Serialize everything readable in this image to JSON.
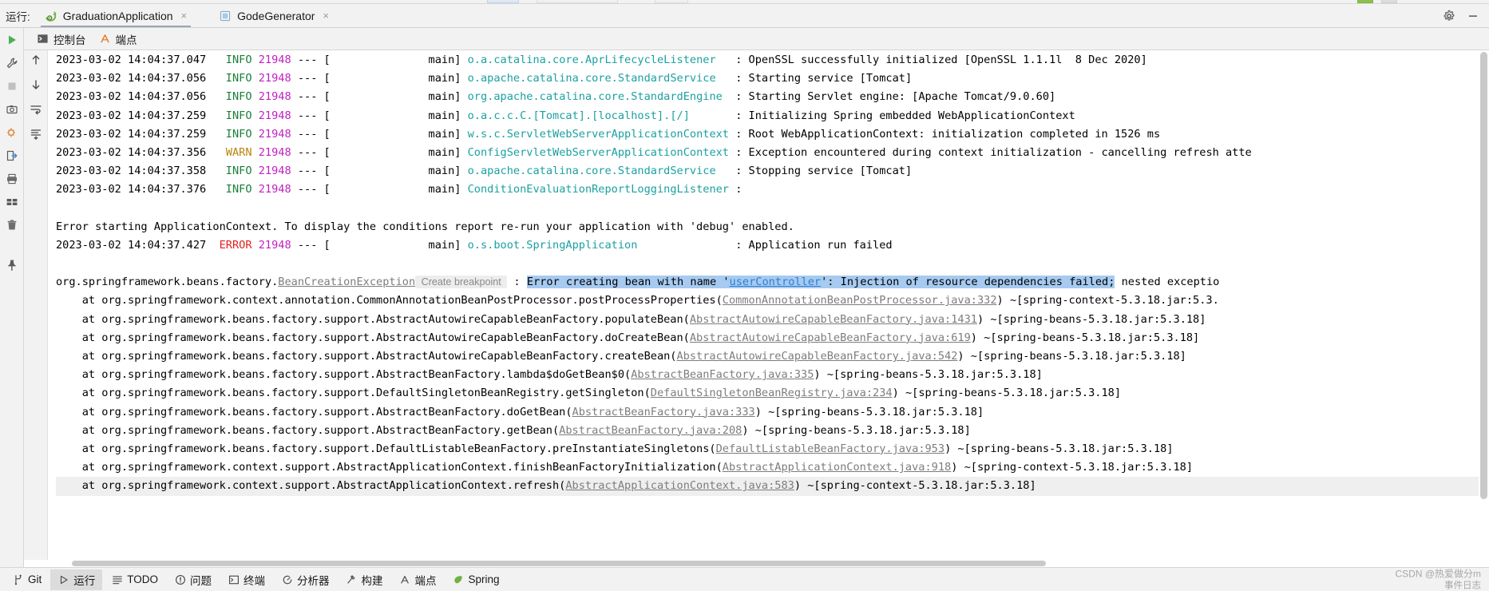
{
  "window": {
    "run_label": "运行:",
    "gear_icon": "gear-icon",
    "minimize_icon": "minimize-icon"
  },
  "tabs": [
    {
      "label": "GraduationApplication",
      "icon": "spring-boot-icon",
      "close": "×",
      "active": true
    },
    {
      "label": "GodeGenerator",
      "icon": "application-icon",
      "close": "×",
      "active": false
    }
  ],
  "console_tabs": [
    {
      "label": "控制台",
      "icon": "console-icon",
      "active": true
    },
    {
      "label": "端点",
      "icon": "endpoints-icon",
      "active": false
    }
  ],
  "left_toolbar": [
    "run-icon",
    "wrench-icon",
    "stop-icon",
    "camera-icon",
    "bug-settings-icon",
    "exit-icon",
    "print-icon",
    "layout-icon",
    "trash-icon",
    "pin-icon"
  ],
  "inner_gutter": [
    "scroll-up-icon",
    "scroll-down-icon",
    "soft-wrap-icon",
    "scroll-to-end-icon"
  ],
  "log": {
    "lines": [
      {
        "type": "log",
        "ts": "2023-03-02 14:04:37.047",
        "level": "INFO",
        "pid": "21948",
        "sep": "--- [",
        "thread": "main]",
        "logger": "o.a.catalina.core.AprLifecycleListener",
        "colon": ":",
        "message": "OpenSSL successfully initialized [OpenSSL 1.1.1l  8 Dec 2020]",
        "clipped": true
      },
      {
        "type": "log",
        "ts": "2023-03-02 14:04:37.056",
        "level": "INFO",
        "pid": "21948",
        "sep": "--- [",
        "thread": "main]",
        "logger": "o.apache.catalina.core.StandardService",
        "colon": ":",
        "message": "Starting service [Tomcat]"
      },
      {
        "type": "log",
        "ts": "2023-03-02 14:04:37.056",
        "level": "INFO",
        "pid": "21948",
        "sep": "--- [",
        "thread": "main]",
        "logger": "org.apache.catalina.core.StandardEngine",
        "colon": ":",
        "message": "Starting Servlet engine: [Apache Tomcat/9.0.60]"
      },
      {
        "type": "log",
        "ts": "2023-03-02 14:04:37.259",
        "level": "INFO",
        "pid": "21948",
        "sep": "--- [",
        "thread": "main]",
        "logger": "o.a.c.c.C.[Tomcat].[localhost].[/]",
        "colon": ":",
        "message": "Initializing Spring embedded WebApplicationContext"
      },
      {
        "type": "log",
        "ts": "2023-03-02 14:04:37.259",
        "level": "INFO",
        "pid": "21948",
        "sep": "--- [",
        "thread": "main]",
        "logger": "w.s.c.ServletWebServerApplicationContext",
        "colon": ":",
        "message": "Root WebApplicationContext: initialization completed in 1526 ms"
      },
      {
        "type": "log",
        "ts": "2023-03-02 14:04:37.356",
        "level": "WARN",
        "pid": "21948",
        "sep": "--- [",
        "thread": "main]",
        "logger": "ConfigServletWebServerApplicationContext",
        "colon": ":",
        "message": "Exception encountered during context initialization - cancelling refresh atte",
        "clipped": true
      },
      {
        "type": "log",
        "ts": "2023-03-02 14:04:37.358",
        "level": "INFO",
        "pid": "21948",
        "sep": "--- [",
        "thread": "main]",
        "logger": "o.apache.catalina.core.StandardService",
        "colon": ":",
        "message": "Stopping service [Tomcat]"
      },
      {
        "type": "log",
        "ts": "2023-03-02 14:04:37.376",
        "level": "INFO",
        "pid": "21948",
        "sep": "--- [",
        "thread": "main]",
        "logger": "ConditionEvaluationReportLoggingListener",
        "colon": ":",
        "message": ""
      },
      {
        "type": "blank"
      },
      {
        "type": "plain",
        "text": "Error starting ApplicationContext. To display the conditions report re-run your application with 'debug' enabled."
      },
      {
        "type": "log",
        "ts": "2023-03-02 14:04:37.427",
        "level": "ERROR",
        "pid": "21948",
        "sep": "--- [",
        "thread": "main]",
        "logger": "o.s.boot.SpringApplication",
        "colon": ":",
        "message": "Application run failed"
      },
      {
        "type": "blank"
      },
      {
        "type": "exception_head",
        "prefix": "org.springframework.beans.factory.",
        "link": "BeanCreationException",
        "breakpoint": "Create breakpoint",
        "colon": ":",
        "sel_before": "Error creating bean with name '",
        "sel_link": "userController",
        "sel_after": "': Injection of resource dependencies failed;",
        "tail": " nested exceptio",
        "clipped": true
      },
      {
        "type": "trace",
        "prefix": "at org.springframework.context.annotation.CommonAnnotationBeanPostProcessor.postProcessProperties(",
        "link": "CommonAnnotationBeanPostProcessor.java:332",
        "suffix": ") ~[spring-context-5.3.18.jar:5.3.",
        "clipped": true
      },
      {
        "type": "trace",
        "prefix": "at org.springframework.beans.factory.support.AbstractAutowireCapableBeanFactory.populateBean(",
        "link": "AbstractAutowireCapableBeanFactory.java:1431",
        "suffix": ") ~[spring-beans-5.3.18.jar:5.3.18]"
      },
      {
        "type": "trace",
        "prefix": "at org.springframework.beans.factory.support.AbstractAutowireCapableBeanFactory.doCreateBean(",
        "link": "AbstractAutowireCapableBeanFactory.java:619",
        "suffix": ") ~[spring-beans-5.3.18.jar:5.3.18]"
      },
      {
        "type": "trace",
        "prefix": "at org.springframework.beans.factory.support.AbstractAutowireCapableBeanFactory.createBean(",
        "link": "AbstractAutowireCapableBeanFactory.java:542",
        "suffix": ") ~[spring-beans-5.3.18.jar:5.3.18]"
      },
      {
        "type": "trace",
        "prefix": "at org.springframework.beans.factory.support.AbstractBeanFactory.lambda$doGetBean$0(",
        "link": "AbstractBeanFactory.java:335",
        "suffix": ") ~[spring-beans-5.3.18.jar:5.3.18]"
      },
      {
        "type": "trace",
        "prefix": "at org.springframework.beans.factory.support.DefaultSingletonBeanRegistry.getSingleton(",
        "link": "DefaultSingletonBeanRegistry.java:234",
        "suffix": ") ~[spring-beans-5.3.18.jar:5.3.18]"
      },
      {
        "type": "trace",
        "prefix": "at org.springframework.beans.factory.support.AbstractBeanFactory.doGetBean(",
        "link": "AbstractBeanFactory.java:333",
        "suffix": ") ~[spring-beans-5.3.18.jar:5.3.18]"
      },
      {
        "type": "trace",
        "prefix": "at org.springframework.beans.factory.support.AbstractBeanFactory.getBean(",
        "link": "AbstractBeanFactory.java:208",
        "suffix": ") ~[spring-beans-5.3.18.jar:5.3.18]"
      },
      {
        "type": "trace",
        "prefix": "at org.springframework.beans.factory.support.DefaultListableBeanFactory.preInstantiateSingletons(",
        "link": "DefaultListableBeanFactory.java:953",
        "suffix": ") ~[spring-beans-5.3.18.jar:5.3.18]"
      },
      {
        "type": "trace",
        "prefix": "at org.springframework.context.support.AbstractApplicationContext.finishBeanFactoryInitialization(",
        "link": "AbstractApplicationContext.java:918",
        "suffix": ") ~[spring-context-5.3.18.jar:5.3.18]"
      },
      {
        "type": "trace",
        "highlighted": true,
        "prefix": "at org.springframework.context.support.AbstractApplicationContext.refresh(",
        "link": "AbstractApplicationContext.java:583",
        "suffix": ") ~[spring-context-5.3.18.jar:5.3.18]"
      }
    ]
  },
  "statusbar": {
    "items": [
      {
        "label": "Git",
        "icon": "git-branch-icon",
        "active": false
      },
      {
        "label": "运行",
        "icon": "run-icon",
        "active": true
      },
      {
        "label": "TODO",
        "icon": "todo-icon",
        "active": false
      },
      {
        "label": "问题",
        "icon": "problems-icon",
        "active": false
      },
      {
        "label": "终端",
        "icon": "terminal-icon",
        "active": false
      },
      {
        "label": "分析器",
        "icon": "profiler-icon",
        "active": false
      },
      {
        "label": "构建",
        "icon": "build-icon",
        "active": false
      },
      {
        "label": "端点",
        "icon": "endpoints-icon",
        "active": false
      },
      {
        "label": "Spring",
        "icon": "spring-leaf-icon",
        "active": false
      }
    ],
    "watermark_line1": "CSDN @热爱做分m",
    "watermark_line2": "事件日志"
  },
  "colors": {
    "accent_selection": "#a6caf0",
    "info": "#1a7f37",
    "warn": "#b8860b",
    "error": "#e02222",
    "pid": "#c020c0",
    "logger": "#1ca0a0",
    "link": "#7d7d7d",
    "chrome": "#f2f2f2"
  }
}
